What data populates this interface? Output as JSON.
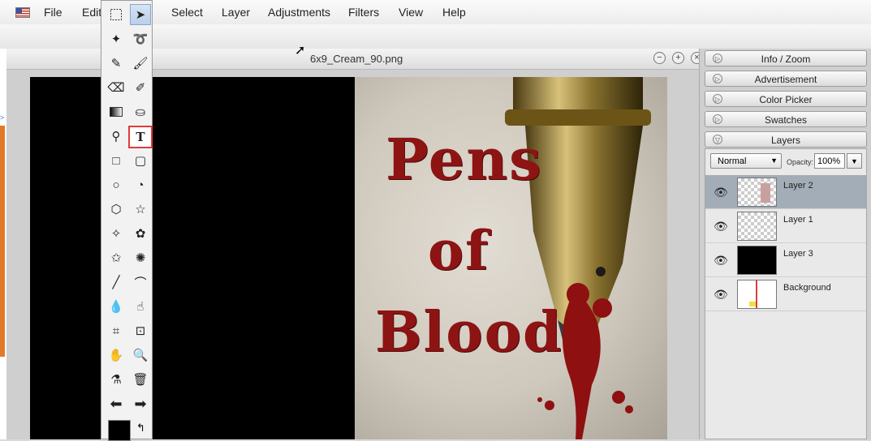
{
  "menu": {
    "items": [
      "File",
      "Edit",
      "Select",
      "Layer",
      "Adjustments",
      "Filters",
      "View",
      "Help"
    ]
  },
  "document": {
    "title": "6x9_Cream_90.png",
    "poster_lines": [
      "Pens",
      "of",
      "Blood"
    ]
  },
  "toolbar": {
    "tools": [
      "marquee-tool",
      "move-tool",
      "magic-wand-tool",
      "lasso-tool",
      "pencil-tool",
      "brush-tool",
      "eraser-tool",
      "dropper-brush-tool",
      "gradient-tool",
      "paint-bucket-tool",
      "stamp-tool",
      "text-tool",
      "rectangle-tool",
      "rounded-rect-tool",
      "ellipse-tool",
      "pie-tool",
      "hexagon-tool",
      "star-tool",
      "burst-tool",
      "flower-tool",
      "blob-tool",
      "gear-tool",
      "line-tool",
      "curve-tool",
      "blur-tool",
      "smudge-tool",
      "crop-tool",
      "transform-tool",
      "hand-tool",
      "zoom-tool",
      "eyedropper-tool",
      "trash-tool",
      "back-arrow-tool",
      "forward-arrow-tool"
    ],
    "active_tool": "text-tool",
    "foreground_color": "#000000"
  },
  "panels": {
    "tabs": [
      "Info / Zoom",
      "Advertisement",
      "Color Picker",
      "Swatches",
      "Layers"
    ]
  },
  "layers": {
    "blend_mode": "Normal",
    "opacity_label": "Opacity:",
    "opacity_value": "100%",
    "items": [
      {
        "name": "Layer 2",
        "selected": true
      },
      {
        "name": "Layer 1",
        "selected": false
      },
      {
        "name": "Layer 3",
        "selected": false
      },
      {
        "name": "Background",
        "selected": false
      }
    ]
  },
  "colors": {
    "title_red": "#8e1414",
    "active_outline": "#e03b3b"
  }
}
